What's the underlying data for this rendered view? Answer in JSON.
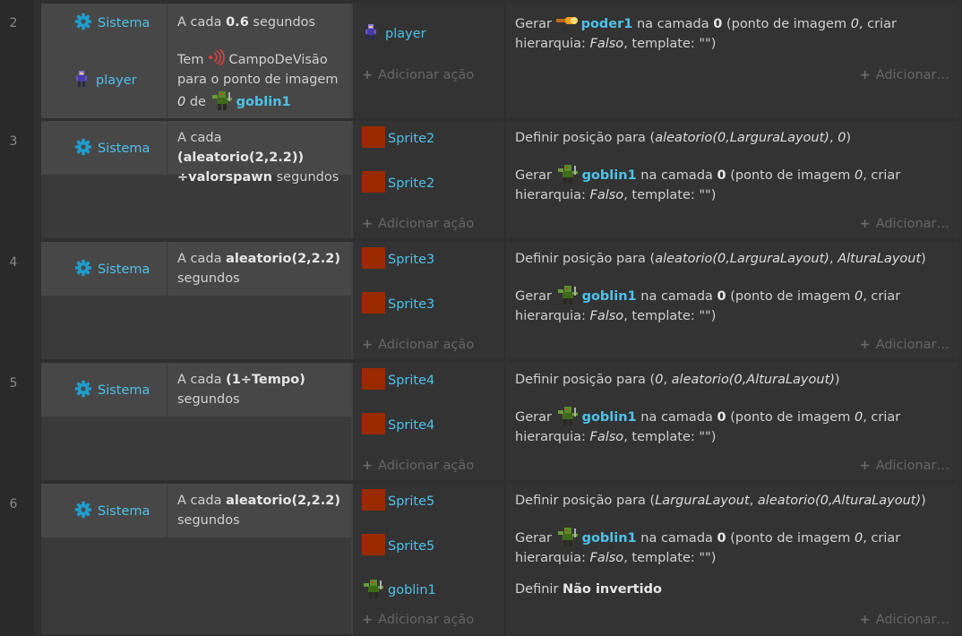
{
  "colors": {
    "object_link": "#4fc1e9",
    "sprite_swatch": "#9b2a00",
    "background": "#2f2f2f"
  },
  "labels": {
    "add_action": "Adicionar ação",
    "add_other": "Adicionar…"
  },
  "events": [
    {
      "row": "2",
      "conditions": [
        {
          "object": "Sistema",
          "text_a": "A cada ",
          "bold": "0.6",
          "text_b": " segundos"
        },
        {
          "object": "player",
          "l1_pre": "Tem",
          "l1_post": "CampoDeVisão",
          "l2": "para o ponto de imagem",
          "l3_param": "0",
          "l3_mid": " de",
          "l3_obj": "goblin1"
        }
      ],
      "actions": [
        {
          "object": "player",
          "pre": "Gerar",
          "obj": "poder1",
          "mid": " na camada ",
          "layer": "0",
          "post": " (ponto de imagem ",
          "p1": "0",
          "post2": ", criar",
          "l2_pre": "hierarquia: ",
          "l2_param": "Falso",
          "l2_post": ", template: \"\")"
        }
      ]
    },
    {
      "row": "3",
      "conditions": [
        {
          "object": "Sistema",
          "text_a": "A cada ",
          "bold1": "(aleatorio(2,2.2))",
          "bold2": "÷valorspawn",
          "text_b": " segundos"
        }
      ],
      "actions": [
        {
          "object": "Sprite2",
          "pre": "Definir posição para (",
          "p1": "aleatorio(0,LarguraLayout)",
          "sep": ", ",
          "p2": "0",
          "post": ")"
        },
        {
          "object": "Sprite2",
          "pre": "Gerar",
          "obj": "goblin1",
          "mid": " na camada ",
          "layer": "0",
          "post": " (ponto de imagem ",
          "p1": "0",
          "post2": ", criar",
          "l2_pre": "hierarquia: ",
          "l2_param": "Falso",
          "l2_post": ", template: \"\")"
        }
      ]
    },
    {
      "row": "4",
      "conditions": [
        {
          "object": "Sistema",
          "text_a": "A cada ",
          "bold": "aleatorio(2,2.2)",
          "text_b": "segundos"
        }
      ],
      "actions": [
        {
          "object": "Sprite3",
          "pre": "Definir posição para (",
          "p1": "aleatorio(0,LarguraLayout)",
          "sep": ", ",
          "p2": "AlturaLayout",
          "post": ")"
        },
        {
          "object": "Sprite3",
          "pre": "Gerar",
          "obj": "goblin1",
          "mid": " na camada ",
          "layer": "0",
          "post": " (ponto de imagem ",
          "p1": "0",
          "post2": ", criar",
          "l2_pre": "hierarquia: ",
          "l2_param": "Falso",
          "l2_post": ", template: \"\")"
        }
      ]
    },
    {
      "row": "5",
      "conditions": [
        {
          "object": "Sistema",
          "text_a": "A cada ",
          "bold": "(1÷Tempo)",
          "text_b": "segundos"
        }
      ],
      "actions": [
        {
          "object": "Sprite4",
          "pre": "Definir posição para (",
          "p1": "0",
          "sep": ", ",
          "p2": "aleatorio(0,AlturaLayout)",
          "post": ")"
        },
        {
          "object": "Sprite4",
          "pre": "Gerar",
          "obj": "goblin1",
          "mid": " na camada ",
          "layer": "0",
          "post": " (ponto de imagem ",
          "p1": "0",
          "post2": ", criar",
          "l2_pre": "hierarquia: ",
          "l2_param": "Falso",
          "l2_post": ", template: \"\")"
        }
      ]
    },
    {
      "row": "6",
      "conditions": [
        {
          "object": "Sistema",
          "text_a": "A cada ",
          "bold": "aleatorio(2,2.2)",
          "text_b": "segundos"
        }
      ],
      "actions": [
        {
          "object": "Sprite5",
          "pre": "Definir posição para (",
          "p1": "LarguraLayout",
          "sep": ", ",
          "p2": "aleatorio(0,AlturaLayout)",
          "post": ")"
        },
        {
          "object": "Sprite5",
          "pre": "Gerar",
          "obj": "goblin1",
          "mid": " na camada ",
          "layer": "0",
          "post": " (ponto de imagem ",
          "p1": "0",
          "post2": ", criar",
          "l2_pre": "hierarquia: ",
          "l2_param": "Falso",
          "l2_post": ", template: \"\")"
        },
        {
          "object": "goblin1",
          "pre": "Definir ",
          "bold": "Não invertido"
        }
      ]
    }
  ]
}
